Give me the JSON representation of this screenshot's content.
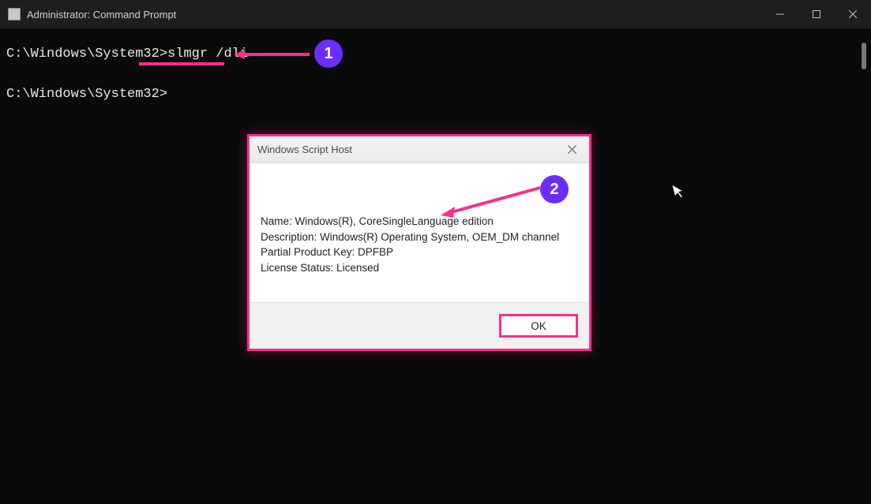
{
  "window": {
    "title": "Administrator: Command Prompt"
  },
  "terminal": {
    "line1_prompt": "C:\\Windows\\System32>",
    "line1_cmd": "slmgr /dli",
    "line2_prompt": "C:\\Windows\\System32>"
  },
  "dialog": {
    "title": "Windows Script Host",
    "lines": {
      "name": "Name: Windows(R), CoreSingleLanguage edition",
      "description": "Description: Windows(R) Operating System, OEM_DM channel",
      "partial_key": "Partial Product Key: DPFBP",
      "license_status": "License Status: Licensed"
    },
    "ok_label": "OK"
  },
  "annotations": {
    "badge1": "1",
    "badge2": "2"
  }
}
